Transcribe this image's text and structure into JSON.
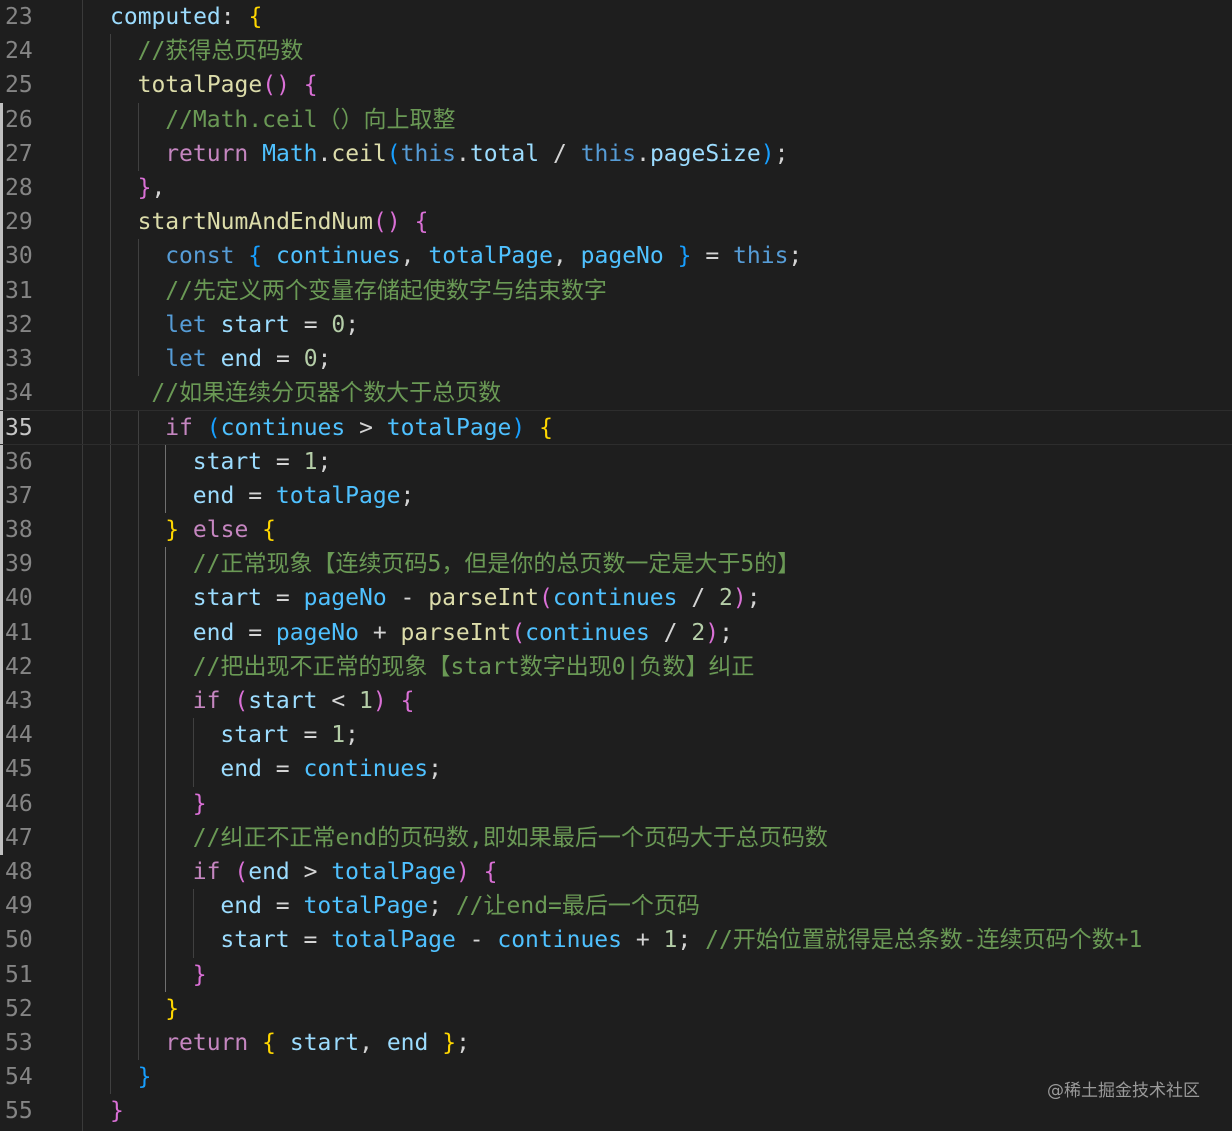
{
  "editor": {
    "current_line": 35,
    "lines": [
      {
        "num": "23",
        "indent": 0,
        "tokens": [
          [
            "computed",
            "prop"
          ],
          [
            ": ",
            "txt"
          ],
          [
            "{",
            "br1"
          ]
        ]
      },
      {
        "num": "24",
        "indent": 1,
        "tokens": [
          [
            "//获得总页码数",
            "cmt"
          ]
        ]
      },
      {
        "num": "25",
        "indent": 1,
        "tokens": [
          [
            "totalPage",
            "fn"
          ],
          [
            "()",
            "br2"
          ],
          [
            " ",
            "txt"
          ],
          [
            "{",
            "br2"
          ]
        ]
      },
      {
        "num": "26",
        "indent": 2,
        "tokens": [
          [
            "//Math.ceil（）向上取整",
            "cmt"
          ]
        ]
      },
      {
        "num": "27",
        "indent": 2,
        "tokens": [
          [
            "return",
            "ctl"
          ],
          [
            " ",
            "txt"
          ],
          [
            "Math",
            "cnst"
          ],
          [
            ".",
            "txt"
          ],
          [
            "ceil",
            "fn"
          ],
          [
            "(",
            "br3"
          ],
          [
            "this",
            "kw"
          ],
          [
            ".",
            "txt"
          ],
          [
            "total",
            "prop"
          ],
          [
            " / ",
            "txt"
          ],
          [
            "this",
            "kw"
          ],
          [
            ".",
            "txt"
          ],
          [
            "pageSize",
            "prop"
          ],
          [
            ")",
            "br3"
          ],
          [
            ";",
            "txt"
          ]
        ]
      },
      {
        "num": "28",
        "indent": 1,
        "tokens": [
          [
            "}",
            "br2"
          ],
          [
            ",",
            "txt"
          ]
        ]
      },
      {
        "num": "29",
        "indent": 1,
        "tokens": [
          [
            "startNumAndEndNum",
            "fn"
          ],
          [
            "()",
            "br2"
          ],
          [
            " ",
            "txt"
          ],
          [
            "{",
            "br2"
          ]
        ]
      },
      {
        "num": "30",
        "indent": 2,
        "tokens": [
          [
            "const",
            "kw"
          ],
          [
            " ",
            "txt"
          ],
          [
            "{",
            "br3"
          ],
          [
            " ",
            "txt"
          ],
          [
            "continues",
            "cnst"
          ],
          [
            ", ",
            "txt"
          ],
          [
            "totalPage",
            "cnst"
          ],
          [
            ", ",
            "txt"
          ],
          [
            "pageNo",
            "cnst"
          ],
          [
            " ",
            "txt"
          ],
          [
            "}",
            "br3"
          ],
          [
            " = ",
            "txt"
          ],
          [
            "this",
            "kw"
          ],
          [
            ";",
            "txt"
          ]
        ]
      },
      {
        "num": "31",
        "indent": 2,
        "tokens": [
          [
            "//先定义两个变量存储起使数字与结束数字",
            "cmt"
          ]
        ]
      },
      {
        "num": "32",
        "indent": 2,
        "tokens": [
          [
            "let",
            "kw"
          ],
          [
            " ",
            "txt"
          ],
          [
            "start",
            "prop"
          ],
          [
            " = ",
            "txt"
          ],
          [
            "0",
            "num"
          ],
          [
            ";",
            "txt"
          ]
        ]
      },
      {
        "num": "33",
        "indent": 2,
        "tokens": [
          [
            "let",
            "kw"
          ],
          [
            " ",
            "txt"
          ],
          [
            "end",
            "prop"
          ],
          [
            " = ",
            "txt"
          ],
          [
            "0",
            "num"
          ],
          [
            ";",
            "txt"
          ]
        ]
      },
      {
        "num": "34",
        "indent": 1.5,
        "tokens": [
          [
            "//如果连续分页器个数大于总页数",
            "cmt"
          ]
        ]
      },
      {
        "num": "35",
        "indent": 2,
        "tokens": [
          [
            "if",
            "ctl"
          ],
          [
            " ",
            "txt"
          ],
          [
            "(",
            "br3"
          ],
          [
            "continues",
            "cnst"
          ],
          [
            " > ",
            "txt"
          ],
          [
            "totalPage",
            "cnst"
          ],
          [
            ")",
            "br3"
          ],
          [
            " ",
            "txt"
          ],
          [
            "{",
            "br1"
          ]
        ]
      },
      {
        "num": "36",
        "indent": 3,
        "tokens": [
          [
            "start",
            "prop"
          ],
          [
            " = ",
            "txt"
          ],
          [
            "1",
            "num"
          ],
          [
            ";",
            "txt"
          ]
        ]
      },
      {
        "num": "37",
        "indent": 3,
        "tokens": [
          [
            "end",
            "prop"
          ],
          [
            " = ",
            "txt"
          ],
          [
            "totalPage",
            "cnst"
          ],
          [
            ";",
            "txt"
          ]
        ]
      },
      {
        "num": "38",
        "indent": 2,
        "tokens": [
          [
            "}",
            "br1"
          ],
          [
            " ",
            "txt"
          ],
          [
            "else",
            "ctl"
          ],
          [
            " ",
            "txt"
          ],
          [
            "{",
            "br1"
          ]
        ]
      },
      {
        "num": "39",
        "indent": 3,
        "tokens": [
          [
            "//正常现象【连续页码5，但是你的总页数一定是大于5的】",
            "cmt"
          ]
        ]
      },
      {
        "num": "40",
        "indent": 3,
        "tokens": [
          [
            "start",
            "prop"
          ],
          [
            " = ",
            "txt"
          ],
          [
            "pageNo",
            "cnst"
          ],
          [
            " - ",
            "txt"
          ],
          [
            "parseInt",
            "fn"
          ],
          [
            "(",
            "br2"
          ],
          [
            "continues",
            "cnst"
          ],
          [
            " / ",
            "txt"
          ],
          [
            "2",
            "num"
          ],
          [
            ")",
            "br2"
          ],
          [
            ";",
            "txt"
          ]
        ]
      },
      {
        "num": "41",
        "indent": 3,
        "tokens": [
          [
            "end",
            "prop"
          ],
          [
            " = ",
            "txt"
          ],
          [
            "pageNo",
            "cnst"
          ],
          [
            " + ",
            "txt"
          ],
          [
            "parseInt",
            "fn"
          ],
          [
            "(",
            "br2"
          ],
          [
            "continues",
            "cnst"
          ],
          [
            " / ",
            "txt"
          ],
          [
            "2",
            "num"
          ],
          [
            ")",
            "br2"
          ],
          [
            ";",
            "txt"
          ]
        ]
      },
      {
        "num": "42",
        "indent": 3,
        "tokens": [
          [
            "//把出现不正常的现象【start数字出现0|负数】纠正",
            "cmt"
          ]
        ]
      },
      {
        "num": "43",
        "indent": 3,
        "tokens": [
          [
            "if",
            "ctl"
          ],
          [
            " ",
            "txt"
          ],
          [
            "(",
            "br2"
          ],
          [
            "start",
            "prop"
          ],
          [
            " < ",
            "txt"
          ],
          [
            "1",
            "num"
          ],
          [
            ")",
            "br2"
          ],
          [
            " ",
            "txt"
          ],
          [
            "{",
            "br2"
          ]
        ]
      },
      {
        "num": "44",
        "indent": 4,
        "tokens": [
          [
            "start",
            "prop"
          ],
          [
            " = ",
            "txt"
          ],
          [
            "1",
            "num"
          ],
          [
            ";",
            "txt"
          ]
        ]
      },
      {
        "num": "45",
        "indent": 4,
        "tokens": [
          [
            "end",
            "prop"
          ],
          [
            " = ",
            "txt"
          ],
          [
            "continues",
            "cnst"
          ],
          [
            ";",
            "txt"
          ]
        ]
      },
      {
        "num": "46",
        "indent": 3,
        "tokens": [
          [
            "}",
            "br2"
          ]
        ]
      },
      {
        "num": "47",
        "indent": 3,
        "tokens": [
          [
            "//纠正不正常end的页码数,即如果最后一个页码大于总页码数",
            "cmt"
          ]
        ]
      },
      {
        "num": "48",
        "indent": 3,
        "tokens": [
          [
            "if",
            "ctl"
          ],
          [
            " ",
            "txt"
          ],
          [
            "(",
            "br2"
          ],
          [
            "end",
            "prop"
          ],
          [
            " > ",
            "txt"
          ],
          [
            "totalPage",
            "cnst"
          ],
          [
            ")",
            "br2"
          ],
          [
            " ",
            "txt"
          ],
          [
            "{",
            "br2"
          ]
        ]
      },
      {
        "num": "49",
        "indent": 4,
        "tokens": [
          [
            "end",
            "prop"
          ],
          [
            " = ",
            "txt"
          ],
          [
            "totalPage",
            "cnst"
          ],
          [
            "; ",
            "txt"
          ],
          [
            "//让end=最后一个页码",
            "cmt"
          ]
        ]
      },
      {
        "num": "50",
        "indent": 4,
        "tokens": [
          [
            "start",
            "prop"
          ],
          [
            " = ",
            "txt"
          ],
          [
            "totalPage",
            "cnst"
          ],
          [
            " - ",
            "txt"
          ],
          [
            "continues",
            "cnst"
          ],
          [
            " + ",
            "txt"
          ],
          [
            "1",
            "num"
          ],
          [
            "; ",
            "txt"
          ],
          [
            "//开始位置就得是总条数-连续页码个数+1",
            "cmt"
          ]
        ]
      },
      {
        "num": "51",
        "indent": 3,
        "tokens": [
          [
            "}",
            "br2"
          ]
        ]
      },
      {
        "num": "52",
        "indent": 2,
        "tokens": [
          [
            "}",
            "br1"
          ]
        ]
      },
      {
        "num": "53",
        "indent": 2,
        "tokens": [
          [
            "return",
            "ctl"
          ],
          [
            " ",
            "txt"
          ],
          [
            "{",
            "br1"
          ],
          [
            " ",
            "txt"
          ],
          [
            "start",
            "prop"
          ],
          [
            ", ",
            "txt"
          ],
          [
            "end",
            "prop"
          ],
          [
            " ",
            "txt"
          ],
          [
            "}",
            "br1"
          ],
          [
            ";",
            "txt"
          ]
        ]
      },
      {
        "num": "54",
        "indent": 1,
        "tokens": [
          [
            "}",
            "br3"
          ]
        ]
      },
      {
        "num": "55",
        "indent": 0,
        "tokens": [
          [
            "}",
            "br2"
          ]
        ]
      }
    ]
  },
  "watermark": "@稀土掘金技术社区",
  "colors": {
    "background": "#1e1e1e",
    "line_number": "#858585",
    "comment": "#6a9955",
    "keyword": "#569cd6",
    "control": "#c586c0",
    "function": "#dcdcaa",
    "variable": "#9cdcfe",
    "constant": "#4fc1ff",
    "number": "#b5cea8"
  }
}
